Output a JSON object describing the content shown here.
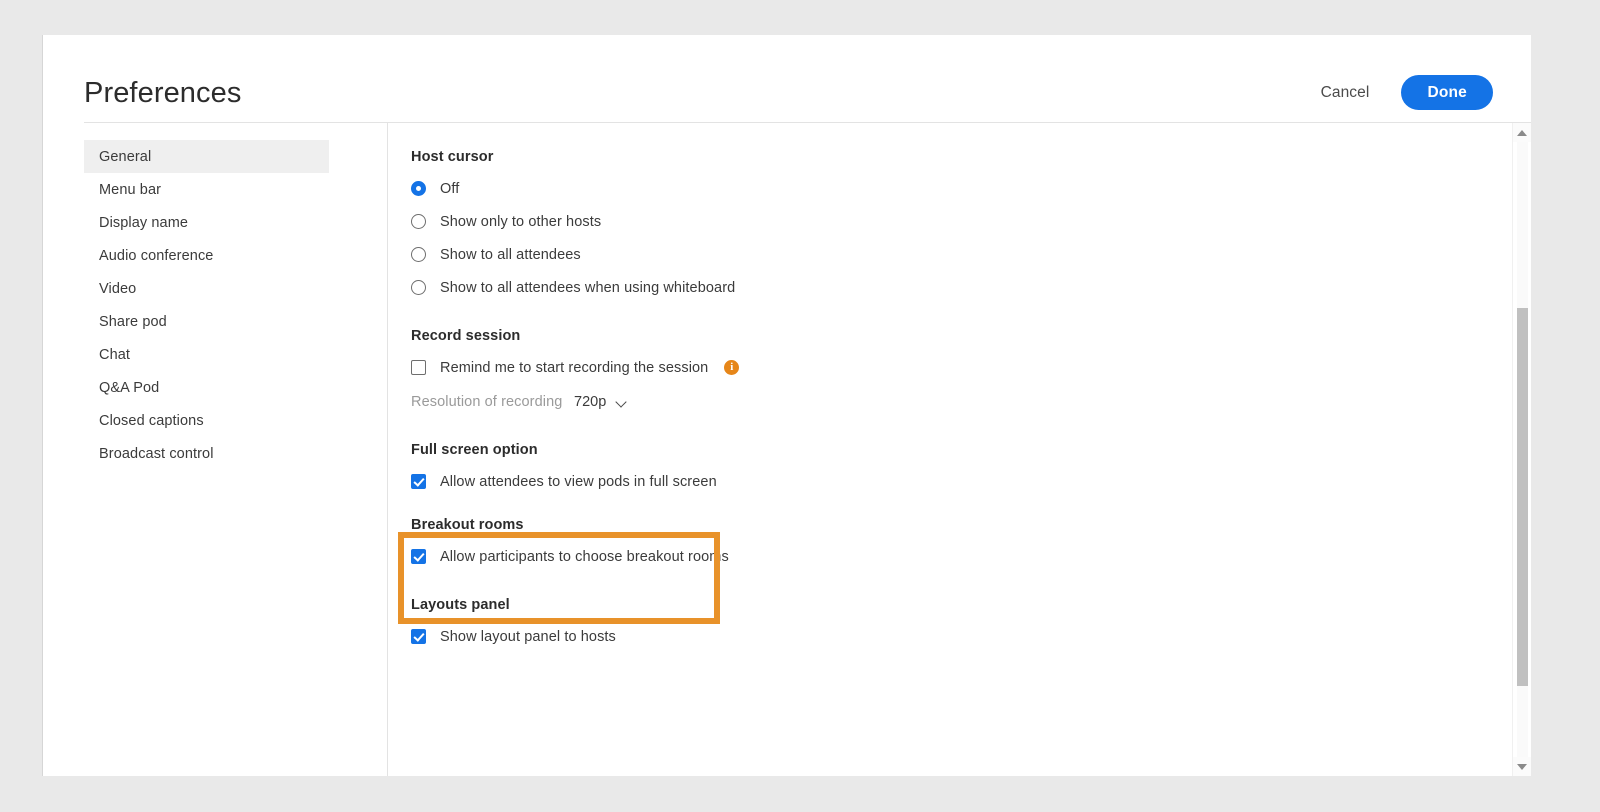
{
  "header": {
    "title": "Preferences",
    "cancel_label": "Cancel",
    "done_label": "Done"
  },
  "sidebar": {
    "items": [
      {
        "label": "General",
        "active": true
      },
      {
        "label": "Menu bar",
        "active": false
      },
      {
        "label": "Display name",
        "active": false
      },
      {
        "label": "Audio conference",
        "active": false
      },
      {
        "label": "Video",
        "active": false
      },
      {
        "label": "Share pod",
        "active": false
      },
      {
        "label": "Chat",
        "active": false
      },
      {
        "label": "Q&A Pod",
        "active": false
      },
      {
        "label": "Closed captions",
        "active": false
      },
      {
        "label": "Broadcast control",
        "active": false
      }
    ]
  },
  "content": {
    "host_cursor": {
      "title": "Host cursor",
      "options": [
        {
          "label": "Off",
          "selected": true
        },
        {
          "label": "Show only to other hosts",
          "selected": false
        },
        {
          "label": "Show to all attendees",
          "selected": false
        },
        {
          "label": "Show to all attendees when using whiteboard",
          "selected": false
        }
      ]
    },
    "record_session": {
      "title": "Record session",
      "remind_label": "Remind me to start recording the session",
      "remind_checked": false,
      "info_glyph": "i",
      "resolution_label": "Resolution of recording",
      "resolution_value": "720p"
    },
    "full_screen": {
      "title": "Full screen option",
      "allow_label": "Allow attendees to view pods in full screen",
      "allow_checked": true
    },
    "breakout_rooms": {
      "title": "Breakout rooms",
      "allow_label": "Allow participants to choose breakout rooms",
      "allow_checked": true,
      "highlight_color": "#e8922a"
    },
    "layouts_panel": {
      "title": "Layouts panel",
      "show_label": "Show layout panel to hosts",
      "show_checked": true
    }
  },
  "scrollbar": {
    "up_icon": "triangle-up-icon",
    "down_icon": "triangle-down-icon"
  },
  "colors": {
    "accent_blue": "#1473e6",
    "highlight_orange": "#e8922a",
    "info_orange": "#e68619"
  }
}
